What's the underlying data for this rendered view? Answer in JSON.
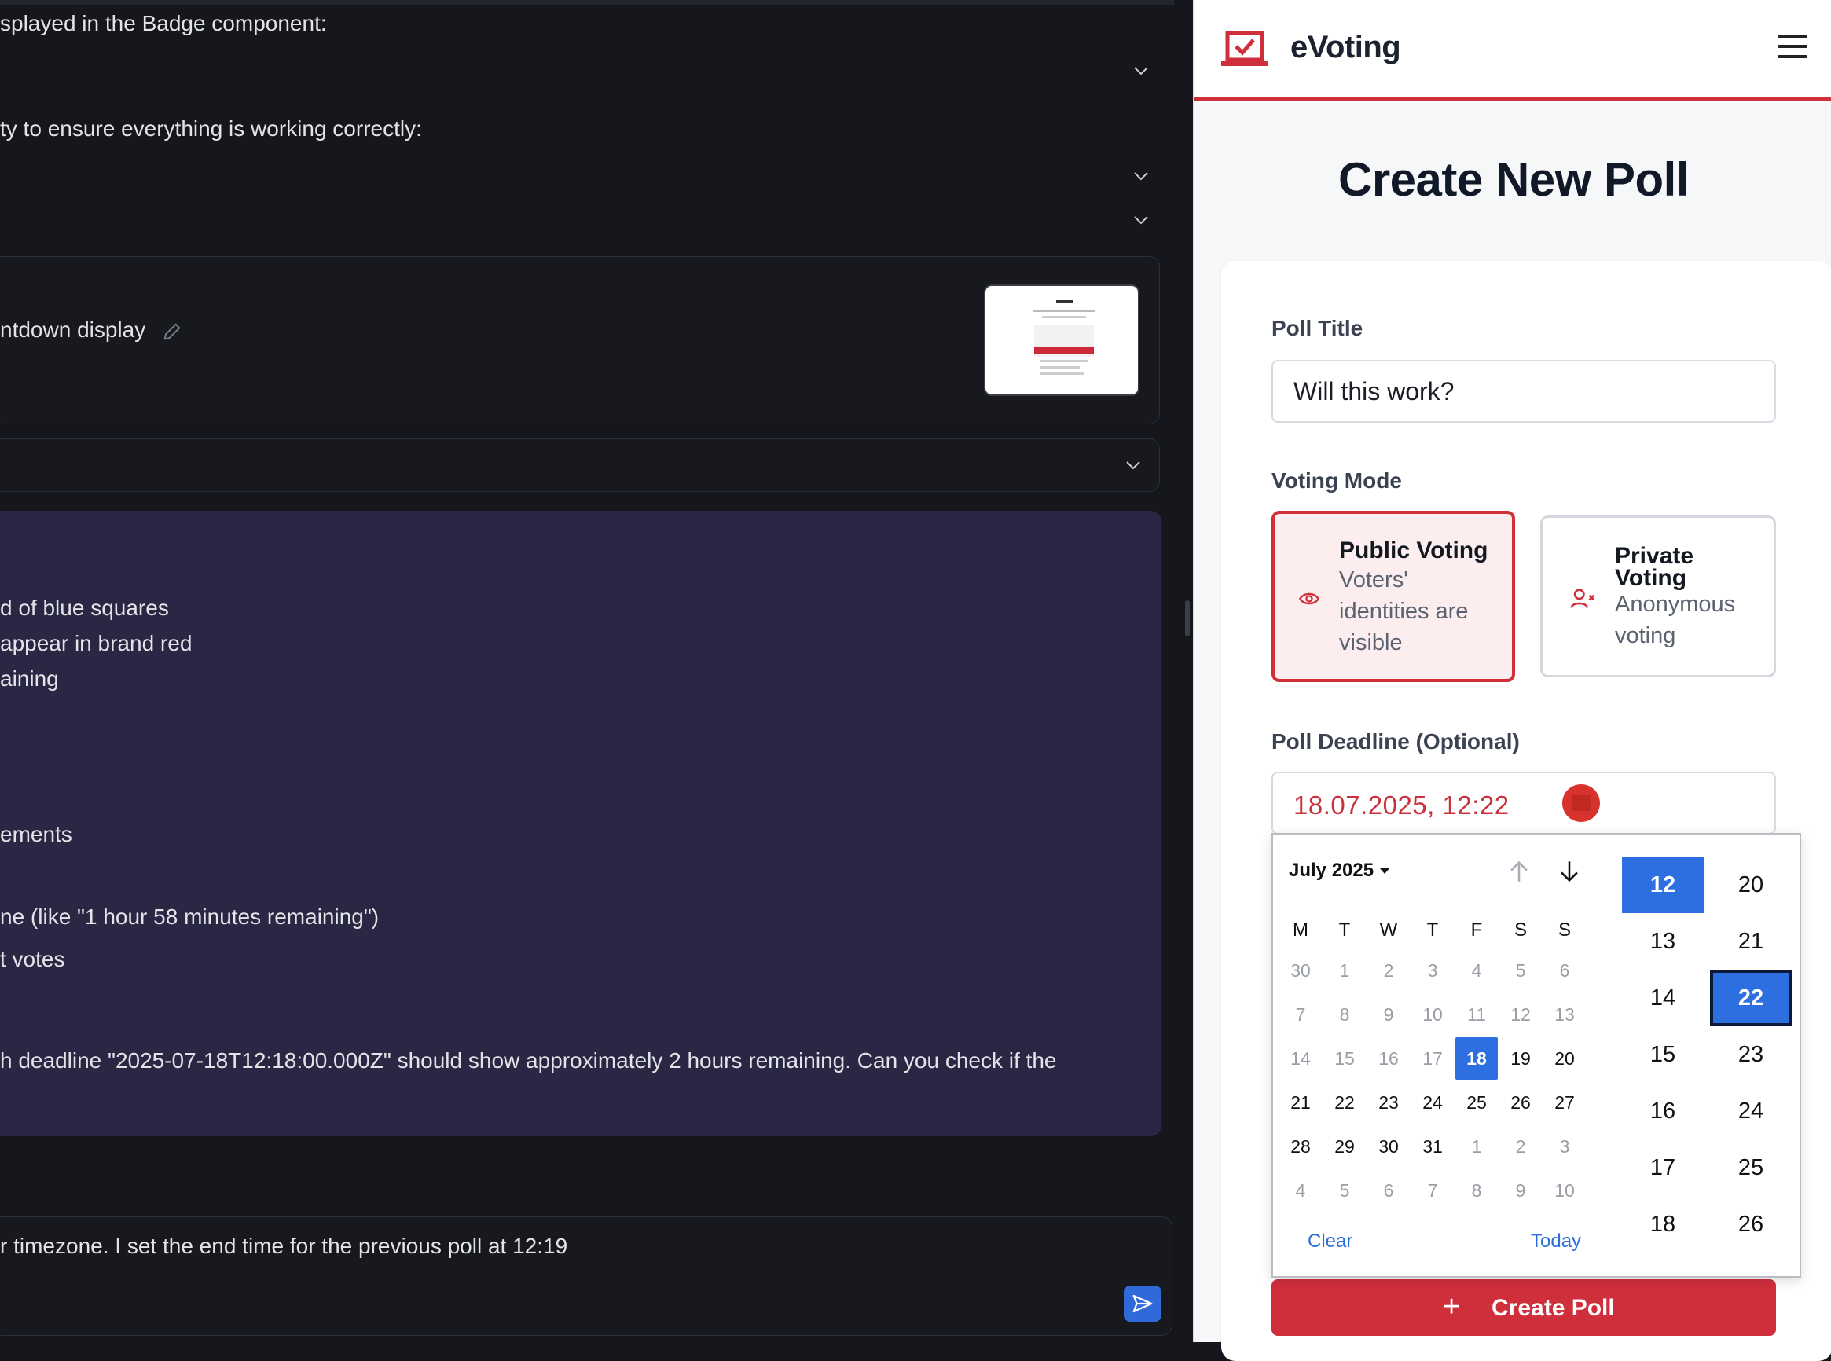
{
  "chat": {
    "lines": [
      "splayed in the Badge component:",
      "ty to ensure everything is working correctly:",
      "ntdown display",
      "d of blue squares",
      "appear in brand red",
      "aining",
      "ements",
      "ne (like \"1 hour 58 minutes remaining\")",
      "t votes",
      "h deadline \"2025-07-18T12:18:00.000Z\" should show approximately 2 hours remaining. Can you check if the"
    ],
    "input_text": "r timezone. I set the end time for the previous poll at 12:19"
  },
  "app": {
    "brand": "eVoting",
    "page_title": "Create New Poll",
    "poll_title_label": "Poll Title",
    "poll_title_value": "Will this work?",
    "voting_mode_label": "Voting Mode",
    "public": {
      "title": "Public Voting",
      "desc_1": "Voters'",
      "desc_2": "identities are",
      "desc_3": "visible"
    },
    "private": {
      "title_1": "Private",
      "title_2": "Voting",
      "desc_1": "Anonymous",
      "desc_2": "voting"
    },
    "deadline_label": "Poll Deadline (Optional)",
    "deadline_value": "18.07.2025, 12:22",
    "create_label": "Create Poll",
    "colors": {
      "brand_red": "#cf2f3b",
      "selection_blue": "#2d6fe0"
    }
  },
  "picker": {
    "month": "July 2025",
    "weekdays": [
      "M",
      "T",
      "W",
      "T",
      "F",
      "S",
      "S"
    ],
    "weeks": [
      [
        [
          "30",
          1
        ],
        [
          "1",
          1
        ],
        [
          "2",
          1
        ],
        [
          "3",
          1
        ],
        [
          "4",
          1
        ],
        [
          "5",
          1
        ],
        [
          "6",
          1
        ]
      ],
      [
        [
          "7",
          1
        ],
        [
          "8",
          1
        ],
        [
          "9",
          1
        ],
        [
          "10",
          1
        ],
        [
          "11",
          1
        ],
        [
          "12",
          1
        ],
        [
          "13",
          1
        ]
      ],
      [
        [
          "14",
          1
        ],
        [
          "15",
          1
        ],
        [
          "16",
          1
        ],
        [
          "17",
          1
        ],
        [
          "18",
          2
        ],
        [
          "19",
          0
        ],
        [
          "20",
          0
        ]
      ],
      [
        [
          "21",
          0
        ],
        [
          "22",
          0
        ],
        [
          "23",
          0
        ],
        [
          "24",
          0
        ],
        [
          "25",
          0
        ],
        [
          "26",
          0
        ],
        [
          "27",
          0
        ]
      ],
      [
        [
          "28",
          0
        ],
        [
          "29",
          0
        ],
        [
          "30",
          0
        ],
        [
          "31",
          0
        ],
        [
          "1",
          1
        ],
        [
          "2",
          1
        ],
        [
          "3",
          1
        ]
      ],
      [
        [
          "4",
          1
        ],
        [
          "5",
          1
        ],
        [
          "6",
          1
        ],
        [
          "7",
          1
        ],
        [
          "8",
          1
        ],
        [
          "9",
          1
        ],
        [
          "10",
          1
        ]
      ]
    ],
    "clear": "Clear",
    "today": "Today",
    "hours": [
      "12",
      "13",
      "14",
      "15",
      "16",
      "17",
      "18"
    ],
    "minutes": [
      "20",
      "21",
      "22",
      "23",
      "24",
      "25",
      "26"
    ],
    "selected_hour": "12",
    "selected_minute": "22"
  }
}
